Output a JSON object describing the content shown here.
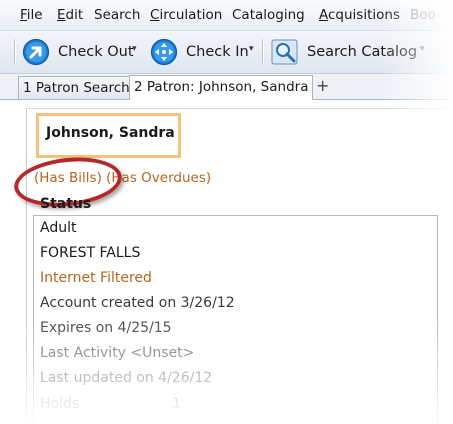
{
  "menu": [
    {
      "label": "File",
      "accel": "F",
      "rest": "ile"
    },
    {
      "label": "Edit",
      "accel": "E",
      "rest": "dit"
    },
    {
      "label": "Search",
      "accel": "",
      "rest": "Search"
    },
    {
      "label": "Circulation",
      "accel": "C",
      "rest": "irculation"
    },
    {
      "label": "Cataloging",
      "accel": "",
      "rest": "Cataloging"
    },
    {
      "label": "Acquisitions",
      "accel": "A",
      "rest": "cquisitions"
    },
    {
      "label": "Boo",
      "accel": "",
      "rest": "Boo"
    }
  ],
  "toolbar": {
    "checkout_label": "Check Out",
    "checkin_label": "Check In",
    "search_catalog_label": "Search Catalog"
  },
  "tabs": [
    {
      "label": "1 Patron Search"
    },
    {
      "label": "2 Patron: Johnson, Sandra"
    }
  ],
  "tab_add": "+",
  "patron": {
    "name": "Johnson, Sandra",
    "alert_bills": "(Has Bills)",
    "alert_overdues": "(Has Overdues)"
  },
  "status": {
    "heading": "Status",
    "rows": [
      {
        "text": "Adult",
        "color": "#1a1a1a"
      },
      {
        "text": "FOREST FALLS",
        "color": "#1a1a1a"
      },
      {
        "text": "Internet Filtered",
        "color": "#b5651d"
      },
      {
        "text": "Account created on 3/26/12",
        "color": "#3a3a3a"
      },
      {
        "text": "Expires on 4/25/15",
        "color": "#4a4a4a"
      },
      {
        "text": "Last Activity <Unset>",
        "color": "#6a6a6a"
      },
      {
        "text": "Last updated on 4/26/12",
        "color": "#7a7a7a"
      },
      {
        "text": "Holds",
        "color": "#9a9a9a"
      }
    ],
    "holds_count": "1"
  },
  "colors": {
    "alert": "#b5651d",
    "name_border": "#f3c278",
    "ring": "#b3282b"
  }
}
